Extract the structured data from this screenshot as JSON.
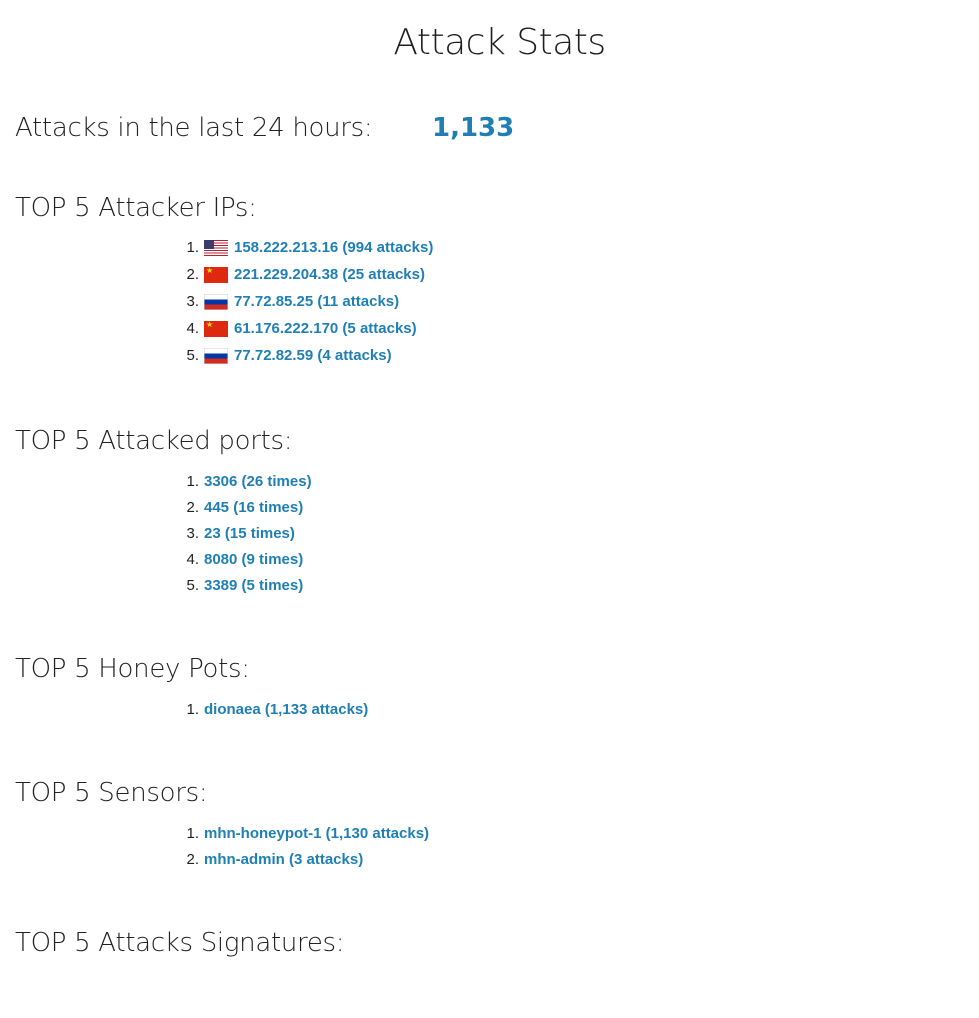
{
  "page": {
    "title": "Attack Stats"
  },
  "summary": {
    "label": "Attacks in the last 24 hours:",
    "value": "1,133"
  },
  "colors": {
    "link": "#1f7fb5",
    "text": "#222222"
  },
  "sections": {
    "attacker_ips": {
      "title": "TOP 5 Attacker IPs:",
      "items": [
        {
          "num": "1.",
          "flag": "us-flag-icon",
          "text": "158.222.213.16 (994 attacks)"
        },
        {
          "num": "2.",
          "flag": "cn-flag-icon",
          "text": "221.229.204.38 (25 attacks)"
        },
        {
          "num": "3.",
          "flag": "ru-flag-icon",
          "text": "77.72.85.25 (11 attacks)"
        },
        {
          "num": "4.",
          "flag": "cn-flag-icon",
          "text": "61.176.222.170 (5 attacks)"
        },
        {
          "num": "5.",
          "flag": "ru-flag-icon",
          "text": "77.72.82.59 (4 attacks)"
        }
      ]
    },
    "attacked_ports": {
      "title": "TOP 5 Attacked ports:",
      "items": [
        {
          "num": "1.",
          "text": "3306 (26 times)"
        },
        {
          "num": "2.",
          "text": "445 (16 times)"
        },
        {
          "num": "3.",
          "text": "23 (15 times)"
        },
        {
          "num": "4.",
          "text": "8080 (9 times)"
        },
        {
          "num": "5.",
          "text": "3389 (5 times)"
        }
      ]
    },
    "honey_pots": {
      "title": "TOP 5 Honey Pots:",
      "items": [
        {
          "num": "1.",
          "text": "dionaea (1,133 attacks)"
        }
      ]
    },
    "sensors": {
      "title": "TOP 5 Sensors:",
      "items": [
        {
          "num": "1.",
          "text": "mhn-honeypot-1 (1,130 attacks)"
        },
        {
          "num": "2.",
          "text": "mhn-admin (3 attacks)"
        }
      ]
    },
    "signatures": {
      "title": "TOP 5 Attacks Signatures:",
      "items": []
    }
  }
}
